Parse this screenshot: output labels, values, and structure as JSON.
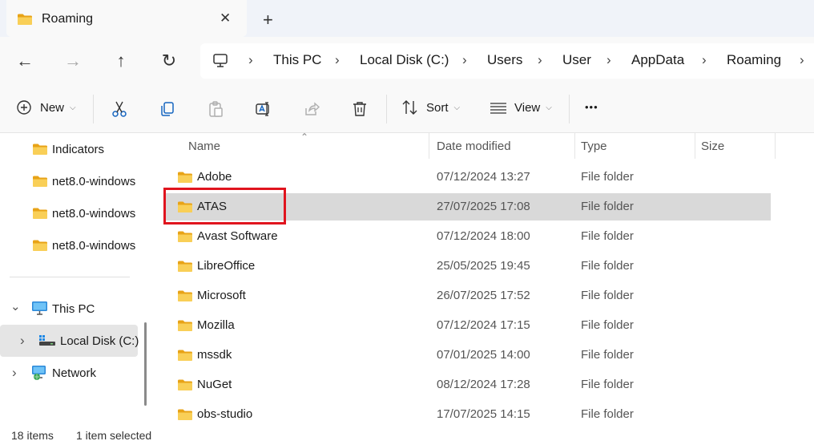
{
  "tab": {
    "title": "Roaming",
    "close": "✕",
    "new": "+"
  },
  "nav": {
    "back": "←",
    "forward": "→",
    "up": "↑",
    "refresh": "↻"
  },
  "breadcrumb": [
    "This PC",
    "Local Disk (C:)",
    "Users",
    "User",
    "AppData",
    "Roaming"
  ],
  "breadcrumb_sep": "›",
  "toolbar": {
    "new_label": "New",
    "sort_label": "Sort",
    "view_label": "View",
    "more_label": "•••",
    "dropdown": "⌵"
  },
  "sidebar": {
    "items": [
      {
        "label": "Indicators"
      },
      {
        "label": "net8.0-windows"
      },
      {
        "label": "net8.0-windows"
      },
      {
        "label": "net8.0-windows"
      }
    ],
    "this_pc": "This PC",
    "local_disk": "Local Disk (C:)",
    "network": "Network",
    "chevron_down": "⌄",
    "chevron_right": "›"
  },
  "columns": {
    "name": "Name",
    "date": "Date modified",
    "type": "Type",
    "size": "Size",
    "sort_caret": "⌃"
  },
  "rows": [
    {
      "name": "Adobe",
      "date": "07/12/2024 13:27",
      "type": "File folder"
    },
    {
      "name": "ATAS",
      "date": "27/07/2025 17:08",
      "type": "File folder"
    },
    {
      "name": "Avast Software",
      "date": "07/12/2024 18:00",
      "type": "File folder"
    },
    {
      "name": "LibreOffice",
      "date": "25/05/2025 19:45",
      "type": "File folder"
    },
    {
      "name": "Microsoft",
      "date": "26/07/2025 17:52",
      "type": "File folder"
    },
    {
      "name": "Mozilla",
      "date": "07/12/2024 17:15",
      "type": "File folder"
    },
    {
      "name": "mssdk",
      "date": "07/01/2025 14:00",
      "type": "File folder"
    },
    {
      "name": "NuGet",
      "date": "08/12/2024 17:28",
      "type": "File folder"
    },
    {
      "name": "obs-studio",
      "date": "17/07/2025 14:15",
      "type": "File folder"
    }
  ],
  "status": {
    "items": "18 items",
    "selected": "1 item selected"
  },
  "colors": {
    "folder": "#f6c54a",
    "selected_row": "#d9d9d9",
    "highlight": "#e0141e"
  }
}
